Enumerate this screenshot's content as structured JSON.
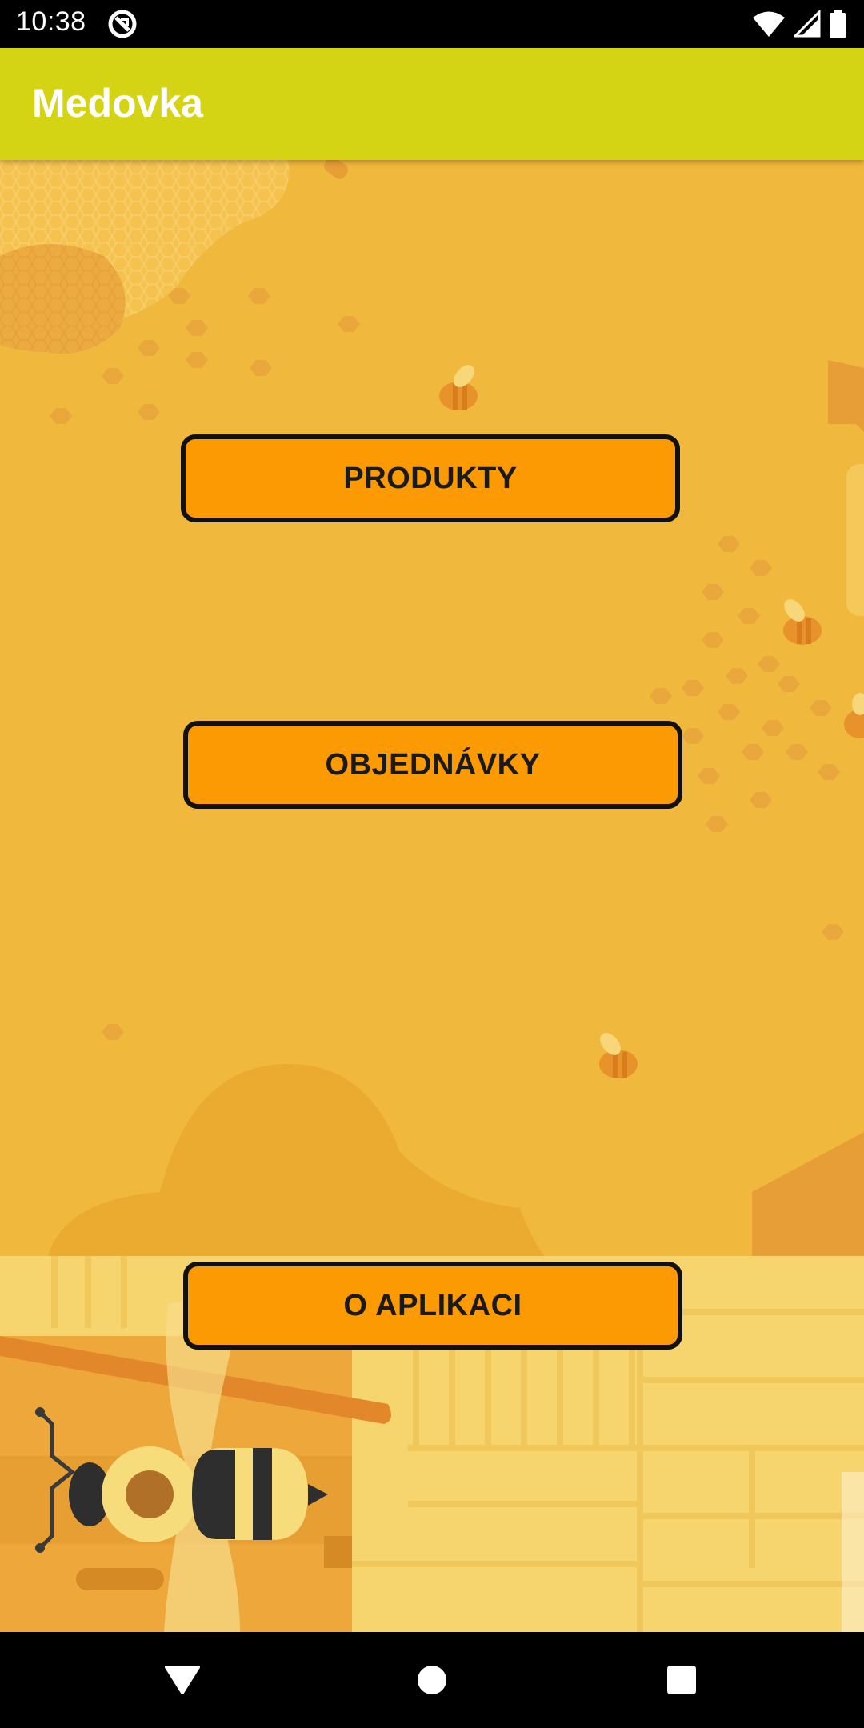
{
  "status_bar": {
    "time": "10:38",
    "icons": [
      "app-notification-icon",
      "wifi-icon",
      "signal-icon",
      "battery-icon"
    ]
  },
  "app_bar": {
    "title": "Medovka",
    "color": "#d4d414"
  },
  "main": {
    "background_color": "#f0b83d",
    "button_color": "#fb9a02",
    "buttons": [
      {
        "label": "PRODUKTY"
      },
      {
        "label": "OBJEDNÁVKY"
      },
      {
        "label": "O APLIKACI"
      }
    ]
  },
  "nav_bar": {
    "buttons": [
      "back-icon",
      "home-icon",
      "recents-icon"
    ]
  }
}
